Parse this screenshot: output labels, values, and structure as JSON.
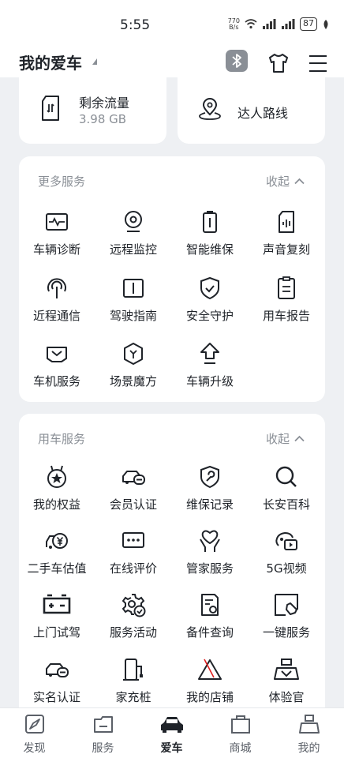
{
  "status_bar": {
    "time": "5:55",
    "net_speed_top": "770",
    "net_speed_bottom": "B/s",
    "battery": "87"
  },
  "header": {
    "title": "我的爱车"
  },
  "quick_cards": [
    {
      "label": "剩余流量",
      "sub": "3.98 GB",
      "icon": "sim-card-icon"
    },
    {
      "label": "达人路线",
      "icon": "location-pin-icon"
    }
  ],
  "more_services": {
    "title": "更多服务",
    "collapse_label": "收起",
    "items": [
      {
        "label": "车辆诊断",
        "icon": "diagnosis-icon"
      },
      {
        "label": "远程监控",
        "icon": "camera-icon"
      },
      {
        "label": "智能维保",
        "icon": "battery-icon"
      },
      {
        "label": "声音复刻",
        "icon": "voice-card-icon"
      },
      {
        "label": "近程通信",
        "icon": "signal-icon"
      },
      {
        "label": "驾驶指南",
        "icon": "book-icon"
      },
      {
        "label": "安全守护",
        "icon": "shield-check-icon"
      },
      {
        "label": "用车报告",
        "icon": "report-icon"
      },
      {
        "label": "车机服务",
        "icon": "car-screen-icon"
      },
      {
        "label": "场景魔方",
        "icon": "cube-icon"
      },
      {
        "label": "车辆升级",
        "icon": "upgrade-arrow-icon"
      }
    ]
  },
  "car_services": {
    "title": "用车服务",
    "collapse_label": "收起",
    "items": [
      {
        "label": "我的权益",
        "icon": "medal-icon"
      },
      {
        "label": "会员认证",
        "icon": "member-car-icon"
      },
      {
        "label": "维保记录",
        "icon": "wrench-shield-icon"
      },
      {
        "label": "长安百科",
        "icon": "search-icon"
      },
      {
        "label": "二手车估值",
        "icon": "yuan-car-icon"
      },
      {
        "label": "在线评价",
        "icon": "comment-icon"
      },
      {
        "label": "管家服务",
        "icon": "heart-hand-icon"
      },
      {
        "label": "5G视频",
        "icon": "video-icon"
      },
      {
        "label": "上门试驾",
        "icon": "test-drive-icon"
      },
      {
        "label": "服务活动",
        "icon": "gear-check-icon"
      },
      {
        "label": "备件查询",
        "icon": "parts-doc-icon"
      },
      {
        "label": "一键服务",
        "icon": "one-tap-icon"
      },
      {
        "label": "实名认证",
        "icon": "id-car-icon"
      },
      {
        "label": "家充桩",
        "icon": "charger-icon"
      },
      {
        "label": "我的店铺",
        "icon": "store-icon"
      },
      {
        "label": "体验官",
        "icon": "experience-icon"
      }
    ]
  },
  "tab_bar": {
    "tabs": [
      {
        "label": "发现",
        "icon": "compass-icon"
      },
      {
        "label": "服务",
        "icon": "service-icon"
      },
      {
        "label": "爱车",
        "icon": "car-icon",
        "active": true
      },
      {
        "label": "商城",
        "icon": "bag-icon"
      },
      {
        "label": "我的",
        "icon": "profile-icon"
      }
    ]
  }
}
